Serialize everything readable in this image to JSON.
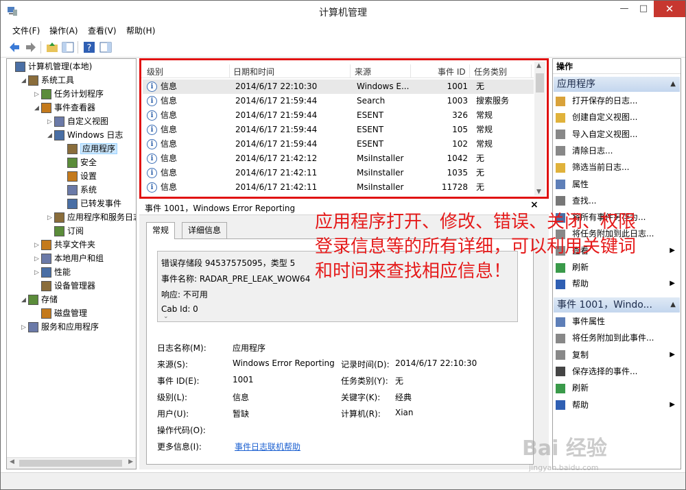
{
  "window": {
    "title": "计算机管理"
  },
  "menu": [
    "文件(F)",
    "操作(A)",
    "查看(V)",
    "帮助(H)"
  ],
  "tree": [
    {
      "label": "计算机管理(本地)",
      "level": 0,
      "exp": ""
    },
    {
      "label": "系统工具",
      "level": 1,
      "exp": "◢"
    },
    {
      "label": "任务计划程序",
      "level": 2,
      "exp": "▷"
    },
    {
      "label": "事件查看器",
      "level": 2,
      "exp": "◢"
    },
    {
      "label": "自定义视图",
      "level": 3,
      "exp": "▷"
    },
    {
      "label": "Windows 日志",
      "level": 3,
      "exp": "◢"
    },
    {
      "label": "应用程序",
      "level": 4,
      "exp": "",
      "selected": true
    },
    {
      "label": "安全",
      "level": 4,
      "exp": ""
    },
    {
      "label": "设置",
      "level": 4,
      "exp": ""
    },
    {
      "label": "系统",
      "level": 4,
      "exp": ""
    },
    {
      "label": "已转发事件",
      "level": 4,
      "exp": ""
    },
    {
      "label": "应用程序和服务日志",
      "level": 3,
      "exp": "▷"
    },
    {
      "label": "订阅",
      "level": 3,
      "exp": ""
    },
    {
      "label": "共享文件夹",
      "level": 2,
      "exp": "▷"
    },
    {
      "label": "本地用户和组",
      "level": 2,
      "exp": "▷"
    },
    {
      "label": "性能",
      "level": 2,
      "exp": "▷"
    },
    {
      "label": "设备管理器",
      "level": 2,
      "exp": ""
    },
    {
      "label": "存储",
      "level": 1,
      "exp": "◢"
    },
    {
      "label": "磁盘管理",
      "level": 2,
      "exp": ""
    },
    {
      "label": "服务和应用程序",
      "level": 1,
      "exp": "▷"
    }
  ],
  "events": {
    "columns": [
      "级别",
      "日期和时间",
      "来源",
      "事件 ID",
      "任务类别"
    ],
    "rows": [
      {
        "level": "信息",
        "datetime": "2014/6/17 22:10:30",
        "source": "Windows E...",
        "id": "1001",
        "category": "无"
      },
      {
        "level": "信息",
        "datetime": "2014/6/17 21:59:44",
        "source": "Search",
        "id": "1003",
        "category": "搜索服务"
      },
      {
        "level": "信息",
        "datetime": "2014/6/17 21:59:44",
        "source": "ESENT",
        "id": "326",
        "category": "常规"
      },
      {
        "level": "信息",
        "datetime": "2014/6/17 21:59:44",
        "source": "ESENT",
        "id": "105",
        "category": "常规"
      },
      {
        "level": "信息",
        "datetime": "2014/6/17 21:59:44",
        "source": "ESENT",
        "id": "102",
        "category": "常规"
      },
      {
        "level": "信息",
        "datetime": "2014/6/17 21:42:12",
        "source": "MsiInstaller",
        "id": "1042",
        "category": "无"
      },
      {
        "level": "信息",
        "datetime": "2014/6/17 21:42:11",
        "source": "MsiInstaller",
        "id": "1035",
        "category": "无"
      },
      {
        "level": "信息",
        "datetime": "2014/6/17 21:42:11",
        "source": "MsiInstaller",
        "id": "11728",
        "category": "无"
      }
    ]
  },
  "detail": {
    "title": "事件 1001，Windows Error Reporting",
    "close": "×",
    "tabs": [
      "常规",
      "详细信息"
    ],
    "desc_lines": [
      "错误存储段 94537575095，类型 5",
      "事件名称: RADAR_PRE_LEAK_WOW64",
      "响应: 不可用",
      "Cab Id: 0"
    ],
    "fields": {
      "log_name_label": "日志名称(M):",
      "log_name": "应用程序",
      "source_label": "来源(S):",
      "source": "Windows Error Reporting",
      "logged_label": "记录时间(D):",
      "logged": "2014/6/17 22:10:30",
      "event_id_label": "事件 ID(E):",
      "event_id": "1001",
      "task_label": "任务类别(Y):",
      "task": "无",
      "level_label": "级别(L):",
      "level": "信息",
      "keywords_label": "关键字(K):",
      "keywords": "经典",
      "user_label": "用户(U):",
      "user": "暂缺",
      "computer_label": "计算机(R):",
      "computer": "Xian",
      "opcode_label": "操作代码(O):",
      "more_label": "更多信息(I):",
      "more_link": "事件日志联机帮助"
    }
  },
  "annotation": [
    "应用程序打开、修改、错误、关闭、权限",
    "登录信息等的所有详细，可以利用关键词",
    "和时间来查找相应信息！"
  ],
  "actions": {
    "title": "操作",
    "group1": "应用程序",
    "items1": [
      "打开保存的日志...",
      "创建自定义视图...",
      "导入自定义视图...",
      "清除日志...",
      "筛选当前日志...",
      "属性",
      "查找...",
      "将所有事件另存为...",
      "将任务附加到此日志...",
      "查看",
      "刷新",
      "帮助"
    ],
    "group2": "事件 1001，Windo...",
    "items2": [
      "事件属性",
      "将任务附加到此事件...",
      "复制",
      "保存选择的事件...",
      "刷新",
      "帮助"
    ]
  },
  "watermark": "Bai 经验",
  "watermark_url": "jingyan.baidu.com"
}
